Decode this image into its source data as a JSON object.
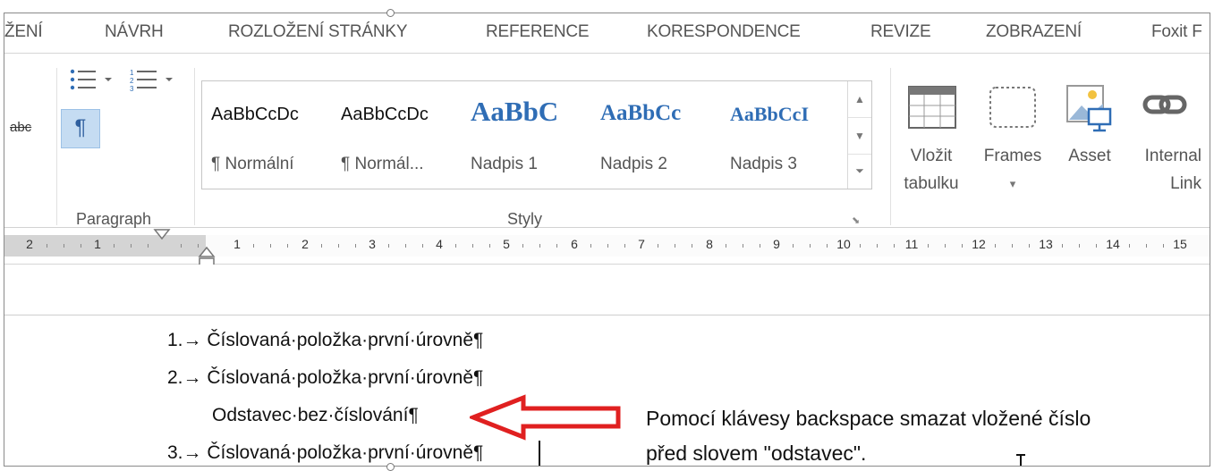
{
  "tabs": [
    "ŽENÍ",
    "NÁVRH",
    "ROZLOŽENÍ STRÁNKY",
    "REFERENCE",
    "KORESPONDENCE",
    "REVIZE",
    "ZOBRAZENÍ",
    "Foxit F"
  ],
  "ribbon": {
    "proofing": {
      "abc_label": "abc"
    },
    "paragraph": {
      "group_label": "Paragraph",
      "pilcrow": "¶"
    },
    "styles": {
      "group_label": "Styly",
      "items": [
        {
          "sample": "AaBbCcDc",
          "name": "¶ Normální"
        },
        {
          "sample": "AaBbCcDc",
          "name": "¶ Normál..."
        },
        {
          "sample": "AaBbC",
          "name": "Nadpis 1"
        },
        {
          "sample": "AaBbCc",
          "name": "Nadpis 2"
        },
        {
          "sample": "AaBbCcI",
          "name": "Nadpis 3"
        }
      ]
    },
    "insert": [
      {
        "line1": "Vložit",
        "line2": "tabulku"
      },
      {
        "line1": "Frames",
        "line2": "▾"
      },
      {
        "line1": "Asset",
        "line2": ""
      },
      {
        "line1": "Internal",
        "line2": "Link"
      }
    ]
  },
  "ruler": {
    "labels": [
      "2",
      "1",
      "1",
      "2",
      "3",
      "4",
      "5",
      "6",
      "7",
      "8",
      "9",
      "10",
      "11",
      "12",
      "13",
      "14",
      "15"
    ]
  },
  "document": {
    "lines": [
      {
        "number": "1.",
        "text": "Číslovaná·položka·první·úrovně"
      },
      {
        "number": "2.",
        "text": "Číslovaná·položka·první·úrovně"
      },
      {
        "number": "",
        "text": "Odstavec·bez·číslování"
      },
      {
        "number": "3.",
        "text": "Číslovaná·položka·první·úrovně"
      }
    ],
    "pilcrow": "¶",
    "tab_arrow": "→"
  },
  "annotation": {
    "line1": "Pomocí klávesy backspace smazat vložené číslo",
    "line2": "před slovem \"odstavec\".",
    "arrow_color": "#e02020"
  },
  "colors": {
    "heading_blue": "#2f6db5",
    "highlight": "#c5dcf2"
  }
}
